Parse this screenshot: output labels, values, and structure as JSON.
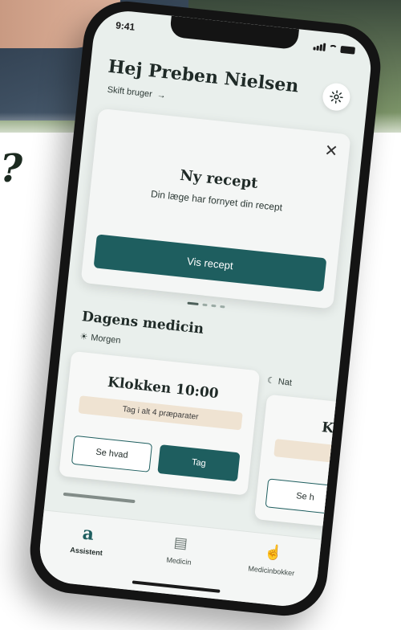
{
  "status_bar": {
    "time": "9:41"
  },
  "header": {
    "greeting": "Hej Preben Nielsen",
    "switch_user": "Skift bruger",
    "switch_arrow": "→",
    "settings_icon": "gear-icon"
  },
  "prescription_card": {
    "title": "Ny recept",
    "subtitle": "Din læge har fornyet din recept",
    "close_glyph": "✕",
    "button": "Vis recept"
  },
  "todays_medicine": {
    "title": "Dagens medicin",
    "morning_label": "Morgen",
    "night_label": "Nat",
    "card": {
      "time": "Klokken 10:00",
      "info": "Tag i alt 4 præparater",
      "see_button": "Se hvad",
      "take_button": "Tag"
    },
    "next_card": {
      "time_peek": "K",
      "see_button_peek": "Se h"
    }
  },
  "tabbar": {
    "tabs": [
      {
        "label": "Assistent",
        "glyph": "a",
        "icon": "assistant-icon"
      },
      {
        "label": "Medicin",
        "glyph": "▤",
        "icon": "medicine-box-icon"
      },
      {
        "label": "Medicinbokker",
        "glyph": "☝",
        "icon": "hand-pointer-icon"
      }
    ]
  },
  "background": {
    "headline_punctuation": "?"
  },
  "colors": {
    "accent": "#1e5e5f",
    "screen_bg": "#e9efec",
    "badge_bg": "#efe3d2"
  }
}
